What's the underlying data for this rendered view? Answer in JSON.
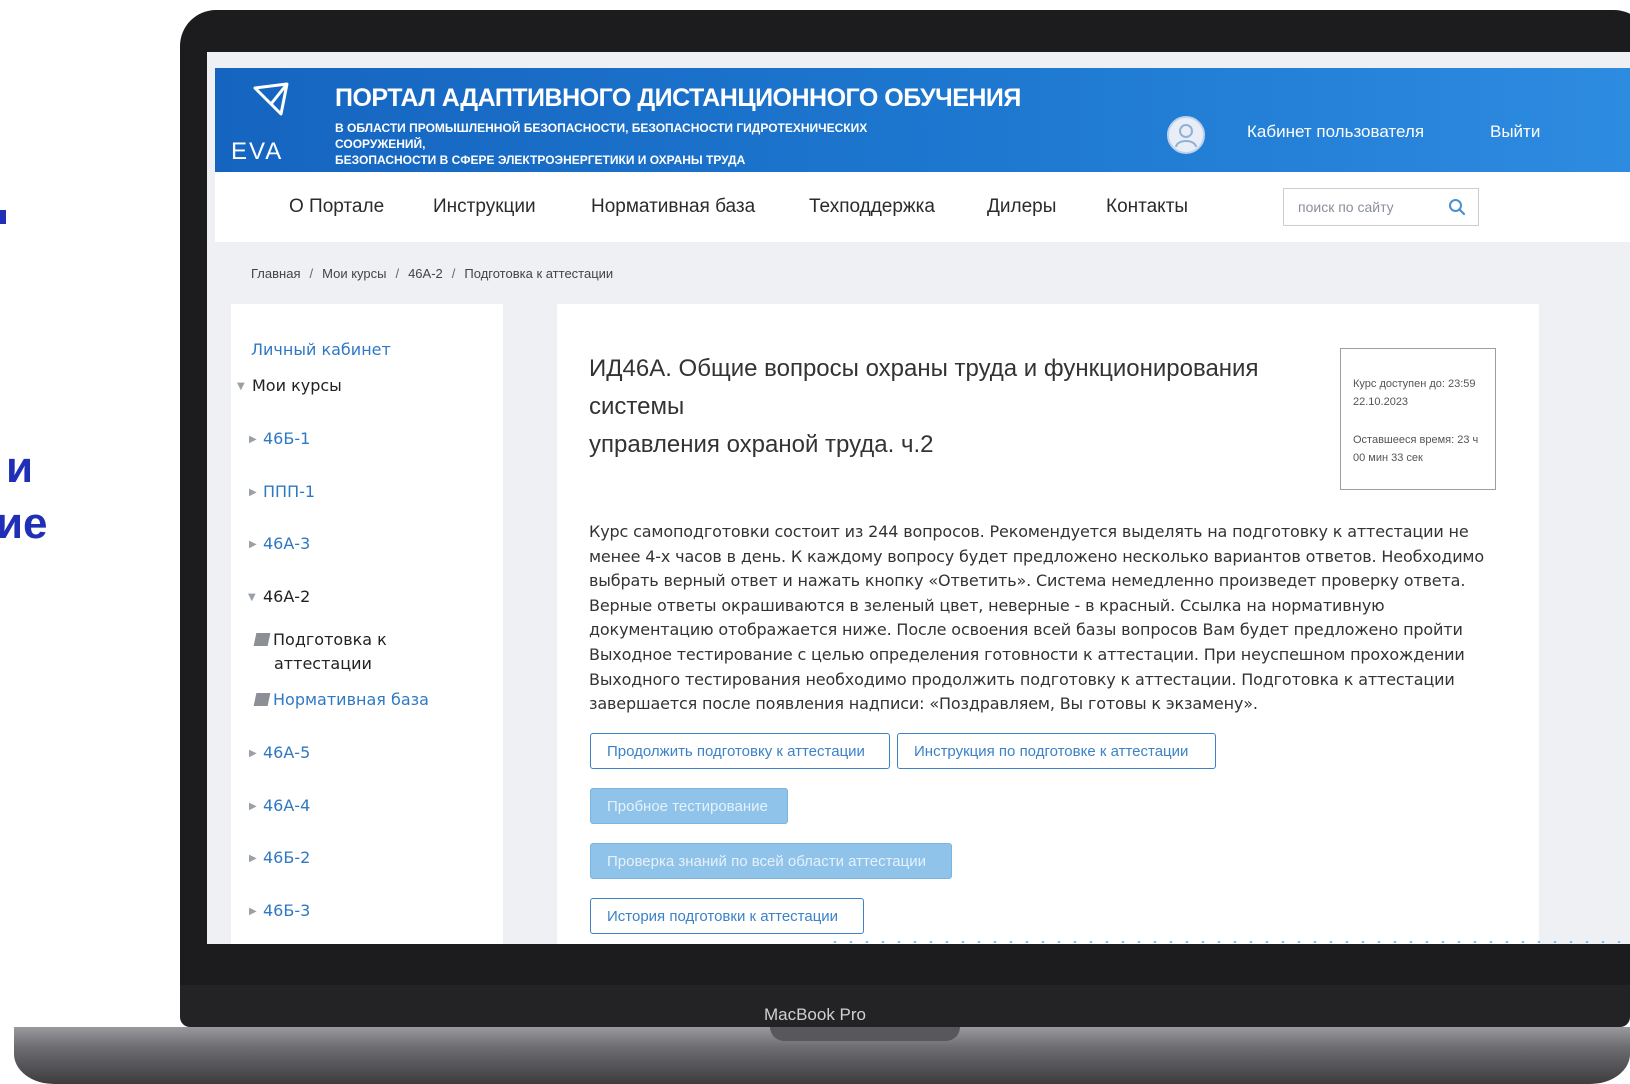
{
  "left_text": {
    "line1": "и",
    "line2": "ие"
  },
  "laptop_label": "MacBook Pro",
  "header": {
    "logo_text": "EVA",
    "title": "ПОРТАЛ АДАПТИВНОГО ДИСТАНЦИОННОГО ОБУЧЕНИЯ",
    "subtitle_line1": "В ОБЛАСТИ ПРОМЫШЛЕННОЙ БЕЗОПАСНОСТИ, БЕЗОПАСНОСТИ ГИДРОТЕХНИЧЕСКИХ СООРУЖЕНИЙ,",
    "subtitle_line2": "БЕЗОПАСНОСТИ В СФЕРЕ ЭЛЕКТРОЭНЕРГЕТИКИ И ОХРАНЫ ТРУДА",
    "cabinet": "Кабинет пользователя",
    "logout": "Выйти"
  },
  "nav": {
    "items": [
      "О Портале",
      "Инструкции",
      "Нормативная база",
      "Техподдержка",
      "Дилеры",
      "Контакты"
    ],
    "search_placeholder": "поиск по сайту"
  },
  "breadcrumb": [
    "Главная",
    "Мои курсы",
    "46А-2",
    "Подготовка к аттестации"
  ],
  "sidebar": {
    "personal": "Личный кабинет",
    "my_courses": "Мои курсы",
    "courses": [
      "46Б-1",
      "ППП-1",
      "46А-3",
      "46А-2",
      "46А-5",
      "46А-4",
      "46Б-2",
      "46Б-3"
    ],
    "sub_items": [
      "Подготовка к",
      "аттестации",
      "Нормативная база"
    ]
  },
  "content": {
    "title_line1": "ИД46А. Общие вопросы охраны труда и функционирования системы",
    "title_line2": "управления охраной труда. ч.2",
    "timer": {
      "available_l1": "Курс доступен до: 23:59",
      "available_l2": "22.10.2023",
      "remaining_l1": "Оставшееся время: 23 ч",
      "remaining_l2": "00 мин 33 сек"
    },
    "description": [
      "Курс самоподготовки состоит из 244 вопросов. Рекомендуется выделять на подготовку к аттестации не",
      "менее 4-х часов в день. К каждому вопросу будет предложено несколько вариантов ответов. Необходимо",
      "выбрать верный ответ и нажать кнопку «Ответить». Система немедленно произведет проверку ответа.",
      "Верные ответы окрашиваются в зеленый цвет, неверные - в красный. Ссылка на нормативную",
      "документацию отображается ниже. После освоения всей базы вопросов Вам будет предложено пройти",
      "Выходное тестирование с целью определения готовности к аттестации. При неуспешном прохождении",
      "Выходного тестирования необходимо продолжить подготовку к аттестации. Подготовка к аттестации",
      "завершается после появления надписи: «Поздравляем, Вы готовы к экзамену»."
    ],
    "buttons": {
      "continue": "Продолжить подготовку к аттестации",
      "instruction": "Инструкция по подготовке к аттестации",
      "trial": "Пробное тестирование",
      "knowledge": "Проверка знаний по всей области аттестации",
      "history": "История подготовки к аттестации"
    }
  },
  "colors": {
    "header_blue": "#1565c0",
    "link_blue": "#2f78c4",
    "button_blue": "#3b82c8",
    "accent_text": "#1f2fb6"
  }
}
